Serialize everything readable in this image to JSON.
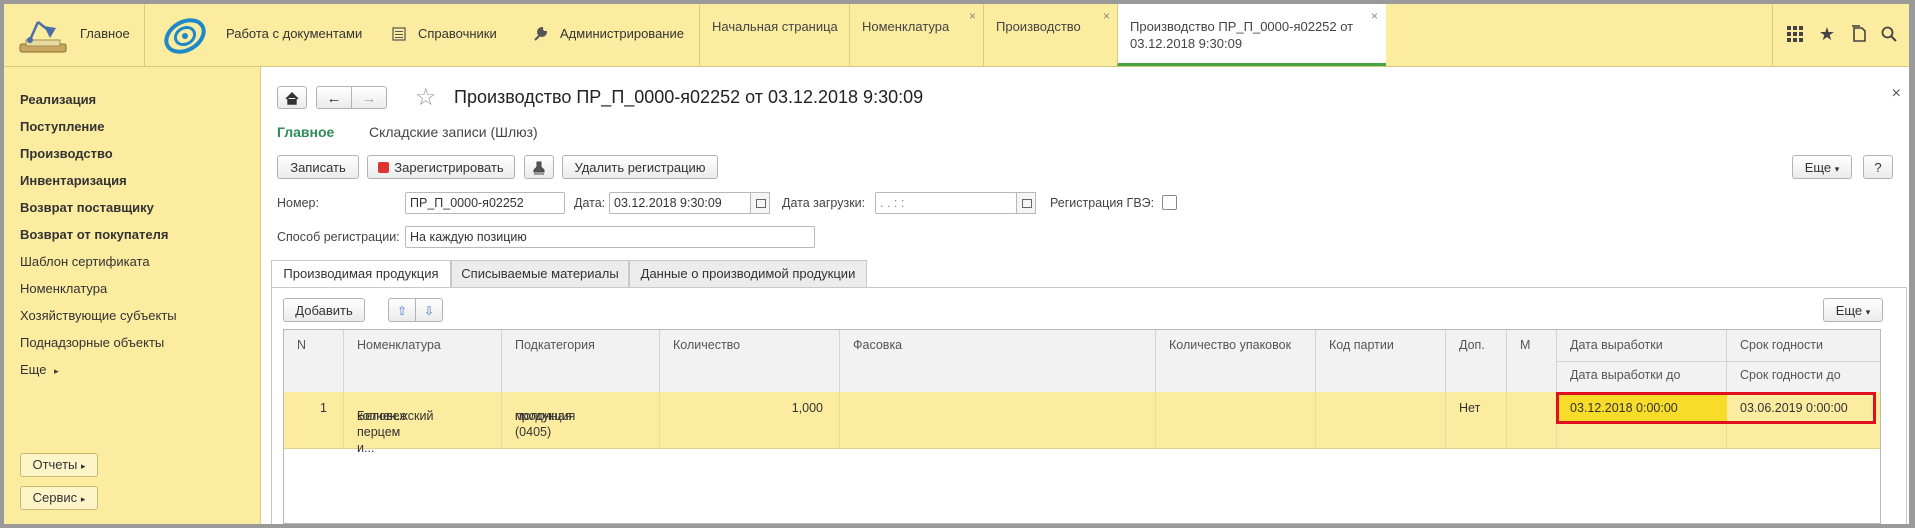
{
  "topbar": {
    "home_label": "Главное",
    "sections": [
      {
        "label": "Работа с документами"
      },
      {
        "label": "Справочники"
      },
      {
        "label": "Администрирование"
      }
    ],
    "tabs": [
      {
        "label": "Начальная страница",
        "closable": false
      },
      {
        "label": "Номенклатура",
        "closable": true
      },
      {
        "label": "Производство",
        "closable": true
      },
      {
        "label_line1": "Производство ПР_П_0000-я02252 от",
        "label_line2": "03.12.2018 9:30:09",
        "closable": true,
        "active": true
      }
    ],
    "close_glyph": "×"
  },
  "sidebar": {
    "items": [
      {
        "label": "Реализация",
        "bold": true
      },
      {
        "label": "Поступление",
        "bold": true
      },
      {
        "label": "Производство",
        "bold": true
      },
      {
        "label": "Инвентаризация",
        "bold": true
      },
      {
        "label": "Возврат поставщику",
        "bold": true
      },
      {
        "label": "Возврат от покупателя",
        "bold": true
      },
      {
        "label": "Шаблон сертификата",
        "bold": false
      },
      {
        "label": "Номенклатура",
        "bold": false
      },
      {
        "label": "Хозяйствующие субъекты",
        "bold": false
      },
      {
        "label": "Поднадзорные объекты",
        "bold": false
      },
      {
        "label": "Еще",
        "bold": false
      }
    ],
    "reports_button": "Отчеты",
    "service_button": "Сервис"
  },
  "document": {
    "title": "Производство ПР_П_0000-я02252 от 03.12.2018 9:30:09",
    "nav_main": "Главное",
    "nav_records": "Складские записи (Шлюз)",
    "toolbar": {
      "save": "Записать",
      "register": "Зарегистрировать",
      "delete_registration": "Удалить регистрацию",
      "more": "Еще",
      "help": "?"
    },
    "fields": {
      "number_label": "Номер:",
      "number_value": "ПР_П_0000-я02252",
      "date_label": "Дата:",
      "date_value": "03.12.2018  9:30:09",
      "load_date_label": "Дата загрузки:",
      "load_date_value": "  .  .        :  :",
      "gve_label": "Регистрация ГВЭ:",
      "gve_checked": false,
      "method_label": "Способ регистрации:",
      "method_value": "На каждую позицию"
    },
    "tabs": [
      "Производимая продукция",
      "Списываемые материалы",
      "Данные о производимой продукции"
    ],
    "table_toolbar": {
      "add": "Добавить",
      "more": "Еще"
    },
    "table": {
      "columns": [
        "N",
        "Номенклатура",
        "Подкатегория",
        "Количество",
        "Фасовка",
        "Количество упаковок",
        "Код партии",
        "Доп.",
        "М",
        "Дата выработки",
        "Срок годности"
      ],
      "subcolumns": {
        "prod_date_to": "Дата выработки до",
        "expiry_to": "Срок годности до"
      },
      "rows": [
        {
          "n": "1",
          "nomenclature_line1": "Беловежский",
          "nomenclature_line2": "копчен.с перцем и...",
          "subcategory_line1": "молочная",
          "subcategory_line2": "продукция (0405)",
          "quantity": "1,000",
          "packing": "",
          "packages": "",
          "batch": "",
          "extra": "Нет",
          "m": "",
          "prod_date": "03.12.2018 0:00:00",
          "expiry": "03.06.2019 0:00:00"
        }
      ]
    }
  },
  "colors": {
    "panel_yellow": "#fbeca0",
    "selected_cell": "#f7dc2a",
    "highlight_red": "#e0101e",
    "active_tab_green": "#46a346",
    "nav_main_green": "#2e8b57"
  }
}
